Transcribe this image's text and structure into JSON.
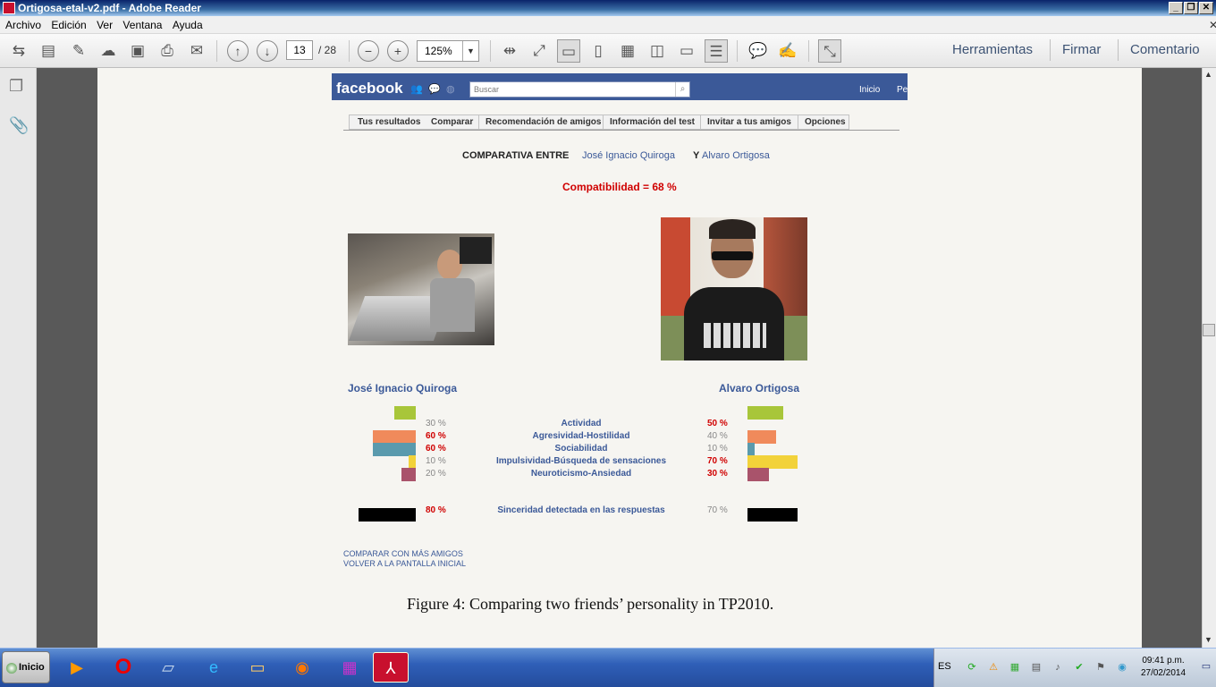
{
  "window": {
    "title": "Ortigosa-etal-v2.pdf - Adobe Reader"
  },
  "menu": [
    "Archivo",
    "Edición",
    "Ver",
    "Ventana",
    "Ayuda"
  ],
  "toolbar": {
    "page_current": "13",
    "page_total": "/ 28",
    "zoom": "125%",
    "right_links": [
      "Herramientas",
      "Firmar",
      "Comentario"
    ]
  },
  "facebook": {
    "logo": "facebook",
    "search_placeholder": "Buscar",
    "nav": [
      "Inicio",
      "Pe"
    ],
    "tabs": [
      "Tus resultados",
      "Comparar",
      "Recomendación de amigos",
      "Información del test",
      "Invitar a tus amigos",
      "Opciones"
    ]
  },
  "comparison": {
    "heading_prefix": "COMPARATIVA ENTRE",
    "person_a": "José Ignacio Quiroga",
    "conjunction": "Y",
    "person_b": "Alvaro Ortigosa",
    "compatibility": "Compatibilidad = 68 %"
  },
  "traits": [
    {
      "label": "Actividad",
      "a": "30 %",
      "b": "50 %",
      "a_val": 30,
      "b_val": 50,
      "color": "#a8c63a"
    },
    {
      "label": "Agresividad-Hostilidad",
      "a": "60 %",
      "b": "40 %",
      "a_val": 60,
      "b_val": 40,
      "color": "#f08a5b"
    },
    {
      "label": "Sociabilidad",
      "a": "60 %",
      "b": "10 %",
      "a_val": 60,
      "b_val": 10,
      "color": "#5a9aad"
    },
    {
      "label": "Impulsividad-Búsqueda de sensaciones",
      "a": "10 %",
      "b": "70 %",
      "a_val": 10,
      "b_val": 70,
      "color": "#f2d23a"
    },
    {
      "label": "Neuroticismo-Ansiedad",
      "a": "20 %",
      "b": "30 %",
      "a_val": 20,
      "b_val": 30,
      "color": "#a9536b"
    }
  ],
  "sincerity": {
    "label": "Sinceridad detectada en las respuestas",
    "a": "80 %",
    "b": "70 %",
    "a_val": 80,
    "b_val": 70
  },
  "footer_links": [
    "COMPARAR CON MÁS AMIGOS",
    "VOLVER A LA PANTALLA INICIAL"
  ],
  "caption": "Figure 4:  Comparing two friends’ personality in TP2010.",
  "taskbar": {
    "start": "Inicio",
    "lang": "ES",
    "time": "09:41 p.m.",
    "date": "27/02/2014"
  }
}
